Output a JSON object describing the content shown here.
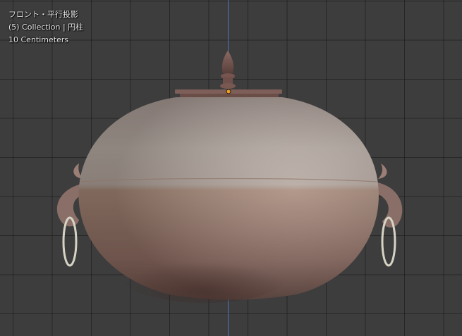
{
  "viewport": {
    "overlay": {
      "view_name": "フロント・平行投影",
      "collection": "(5) Collection | 円柱",
      "scale": "10 Centimeters"
    },
    "colors": {
      "background": "#3d3d3d",
      "grid_line": "#2a2a2a",
      "z_axis": "#4f76b0",
      "origin_dot": "#f0a020",
      "pot_upper": "#b2a49c",
      "pot_lower": "#a07e70",
      "ring": "#d8d6c8"
    },
    "object": {
      "type": "3d-model",
      "subject": "ceramic teapot with lid knob, side handles and rings"
    }
  }
}
